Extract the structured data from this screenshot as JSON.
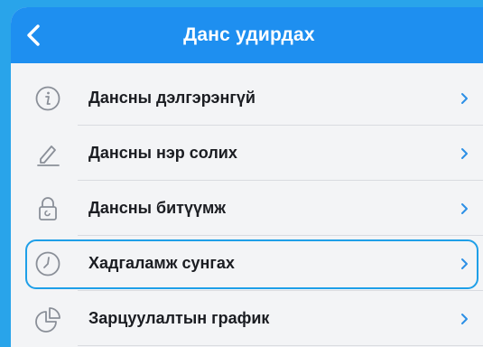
{
  "header": {
    "title": "Данс удирдах"
  },
  "menu": {
    "items": [
      {
        "label": "Дансны дэлгэрэнгүй",
        "icon": "info-icon"
      },
      {
        "label": "Дансны нэр солих",
        "icon": "pencil-icon"
      },
      {
        "label": "Дансны битүүмж",
        "icon": "lock-icon"
      },
      {
        "label": "Хадгаламж сунгах",
        "icon": "clock-icon",
        "highlighted": true
      },
      {
        "label": "Зарцуулалтын график",
        "icon": "pie-chart-icon"
      }
    ]
  },
  "colors": {
    "background": "#29a4ea",
    "header": "#1e8ff0",
    "highlight": "#1e9fe8",
    "chevron": "#2b8fe6"
  }
}
